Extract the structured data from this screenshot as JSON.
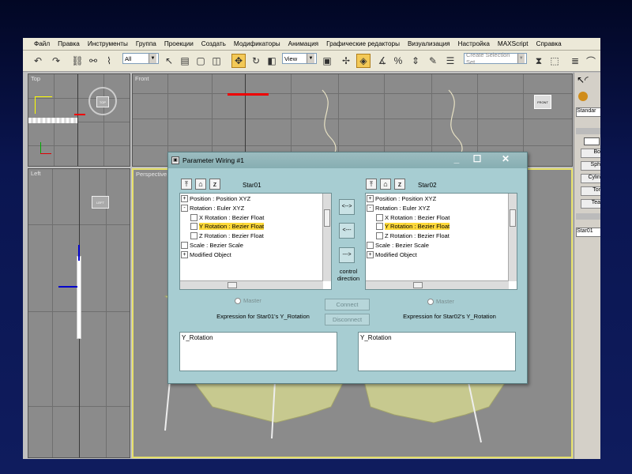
{
  "menu": [
    "Файл",
    "Правка",
    "Инструменты",
    "Группа",
    "Проекции",
    "Создать",
    "Модификаторы",
    "Анимация",
    "Графические редакторы",
    "Визуализация",
    "Настройка",
    "MAXScript",
    "Справка"
  ],
  "toolbar": {
    "filter_value": "All",
    "refcoord_value": "View",
    "selection_set_placeholder": "Create Selection Set"
  },
  "viewports": {
    "top": "Top",
    "front": "Front",
    "left": "Left",
    "perspective": "Perspective"
  },
  "viewcube": {
    "top": "TOP",
    "front": "FRONT",
    "left": "LEFT"
  },
  "command_panel": {
    "items": [
      "Standar",
      "Bo",
      "Sph",
      "Cylin",
      "Tor",
      "Tea",
      "Star01"
    ]
  },
  "dialog": {
    "title": "Parameter Wiring #1",
    "left_object": "Star01",
    "right_object": "Star02",
    "tree_rows": [
      {
        "label": "Position : Position XYZ",
        "indent": 0,
        "box": "+",
        "selected": false
      },
      {
        "label": "Rotation : Euler XYZ",
        "indent": 0,
        "box": "-",
        "selected": false
      },
      {
        "label": "X Rotation : Bezier Float",
        "indent": 1,
        "box": "",
        "selected": false
      },
      {
        "label": "Y Rotation : Bezier Float",
        "indent": 1,
        "box": "",
        "selected": true
      },
      {
        "label": "Z Rotation : Bezier Float",
        "indent": 1,
        "box": "",
        "selected": false
      },
      {
        "label": "Scale : Bezier Scale",
        "indent": 0,
        "box": "",
        "selected": false
      },
      {
        "label": "Modified Object",
        "indent": 0,
        "box": "+",
        "selected": false
      }
    ],
    "arrow_buttons": [
      "<-->",
      "<---",
      "--->"
    ],
    "control_direction": "control direction",
    "master_label": "Master",
    "connect_label": "Connect",
    "disconnect_label": "Disconnect",
    "left_expr_label": "Expression for Star01's Y_Rotation",
    "right_expr_label": "Expression for Star02's Y_Rotation",
    "left_expr": "Y_Rotation",
    "right_expr": "Y_Rotation"
  }
}
